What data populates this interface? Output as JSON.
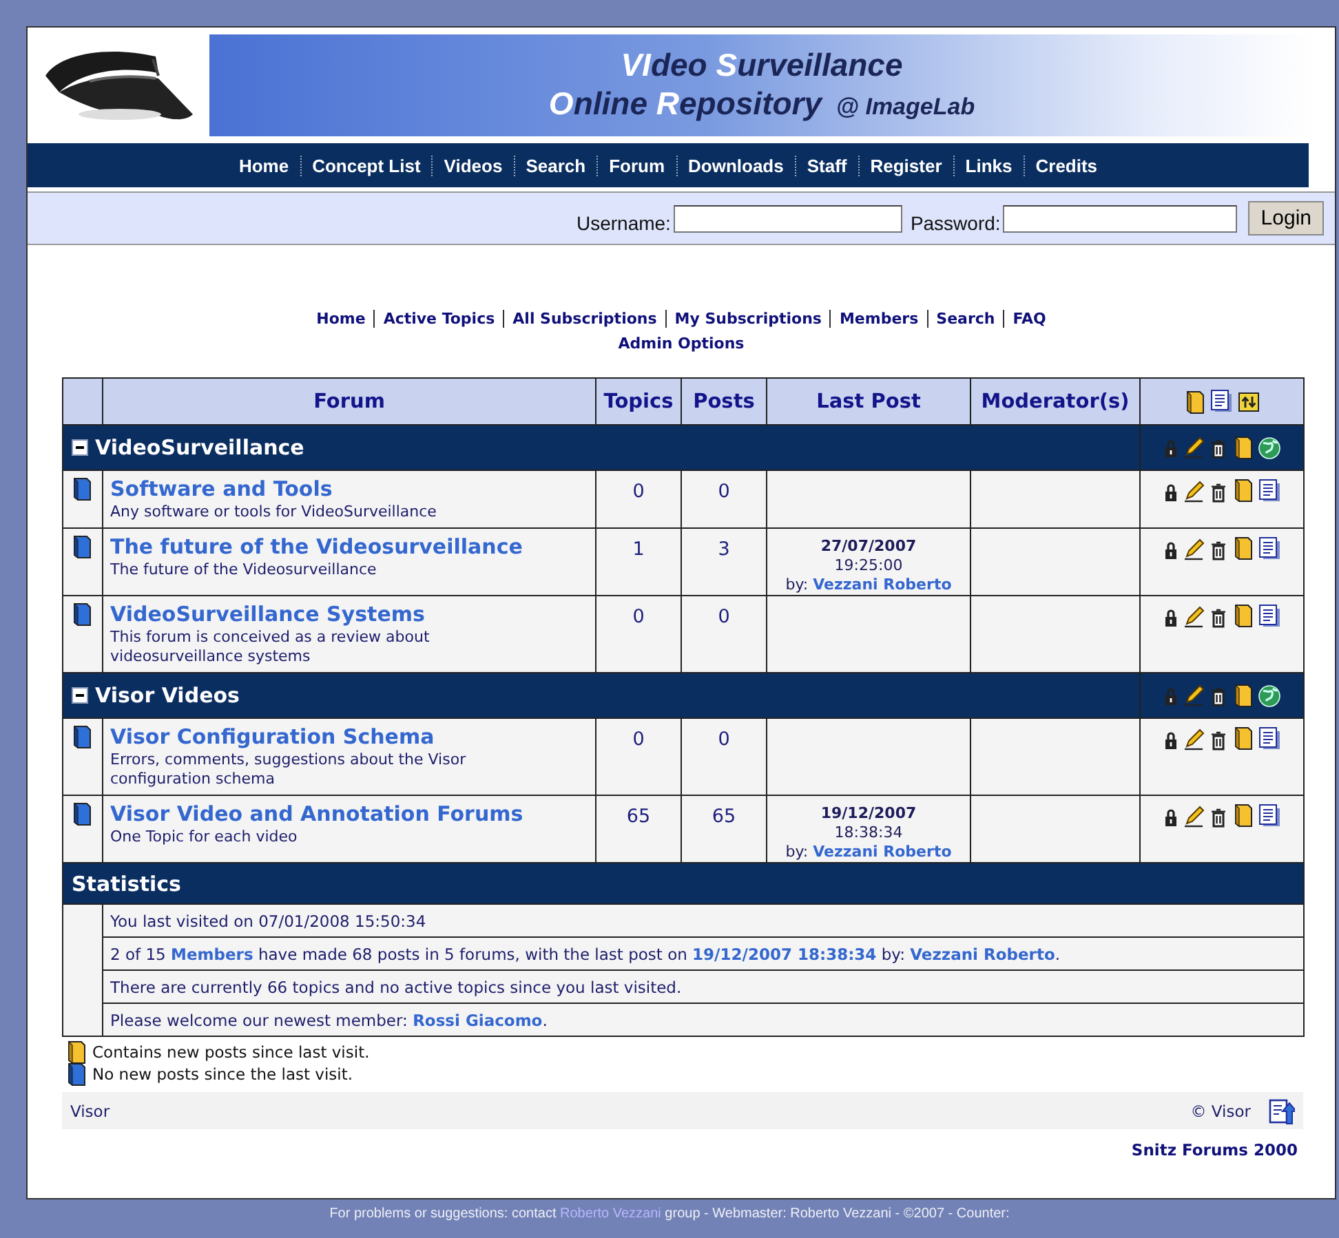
{
  "header": {
    "title_lines": [
      [
        {
          "text": "VI",
          "highlight": true
        },
        {
          "text": "deo ",
          "highlight": false
        },
        {
          "text": "S",
          "highlight": true
        },
        {
          "text": "urveillance",
          "highlight": false
        }
      ],
      [
        {
          "text": "O",
          "highlight": true
        },
        {
          "text": "nline ",
          "highlight": false
        },
        {
          "text": "R",
          "highlight": true
        },
        {
          "text": "epository",
          "highlight": false
        }
      ]
    ],
    "tagline": "@ ImageLab"
  },
  "main_nav": [
    "Home",
    "Concept List",
    "Videos",
    "Search",
    "Forum",
    "Downloads",
    "Staff",
    "Register",
    "Links",
    "Credits"
  ],
  "login": {
    "username_label": "Username:",
    "password_label": "Password:",
    "button": "Login"
  },
  "forum_nav": {
    "links": [
      "Home",
      "Active Topics",
      "All Subscriptions",
      "My Subscriptions",
      "Members",
      "Search",
      "FAQ"
    ],
    "second_line": "Admin Options"
  },
  "forum_table": {
    "columns": [
      "Forum",
      "Topics",
      "Posts",
      "Last Post",
      "Moderator(s)"
    ],
    "categories": [
      {
        "name": "VideoSurveillance",
        "expanded": true,
        "forums": [
          {
            "title": "Software and Tools",
            "description": "Any software or tools for VideoSurveillance",
            "topics": "0",
            "posts": "0",
            "new_posts": false
          },
          {
            "title": "The future of the Videosurveillance",
            "description": "The future of the Videosurveillance",
            "topics": "1",
            "posts": "3",
            "new_posts": false,
            "last_post": {
              "date": "27/07/2007",
              "time": "19:25:00",
              "by": "by:",
              "author": "Vezzani Roberto"
            }
          },
          {
            "title": "VideoSurveillance Systems",
            "description": "This forum is conceived as a review about\nvideosurveillance systems",
            "topics": "0",
            "posts": "0",
            "new_posts": false
          }
        ]
      },
      {
        "name": "Visor Videos",
        "expanded": true,
        "forums": [
          {
            "title": "Visor Configuration Schema",
            "description": "Errors, comments, suggestions about the Visor\nconfiguration schema",
            "topics": "0",
            "posts": "0",
            "new_posts": false
          },
          {
            "title": "Visor Video and Annotation Forums",
            "description": "One Topic for each video",
            "topics": "65",
            "posts": "65",
            "new_posts": false,
            "last_post": {
              "date": "19/12/2007",
              "time": "18:38:34",
              "by": "by:",
              "author": "Vezzani Roberto"
            }
          }
        ]
      }
    ]
  },
  "statistics": {
    "title": "Statistics",
    "lines": [
      [
        {
          "text": "You last visited on 07/01/2008 15:50:34",
          "link": false
        }
      ],
      [
        {
          "text": "2 of 15 ",
          "link": false
        },
        {
          "text": "Members",
          "link": true
        },
        {
          "text": " have made 68 posts in 5 forums, with the last post on ",
          "link": false
        },
        {
          "text": "19/12/2007 18:38:34",
          "link": true
        },
        {
          "text": " by: ",
          "link": false
        },
        {
          "text": "Vezzani Roberto",
          "link": true
        },
        {
          "text": ".",
          "link": false
        }
      ],
      [
        {
          "text": "There are currently 66 topics and no active topics since you last visited.",
          "link": false
        }
      ],
      [
        {
          "text": "Please welcome our newest member: ",
          "link": false
        },
        {
          "text": "Rossi Giacomo",
          "link": true
        },
        {
          "text": ".",
          "link": false
        }
      ]
    ]
  },
  "legend": [
    {
      "text": "Contains new posts since last visit.",
      "new_posts": true
    },
    {
      "text": "No new posts since the last visit.",
      "new_posts": false
    }
  ],
  "footer": {
    "left": "Visor",
    "right": "© Visor",
    "credit": "Snitz Forums 2000"
  },
  "bottom_bar": [
    {
      "text": "For problems or suggestions: contact ",
      "link": false
    },
    {
      "text": "Roberto Vezzani",
      "link": true
    },
    {
      "text": " group - Webmaster: Roberto Vezzani - ©2007 - Counter:",
      "link": false
    }
  ]
}
